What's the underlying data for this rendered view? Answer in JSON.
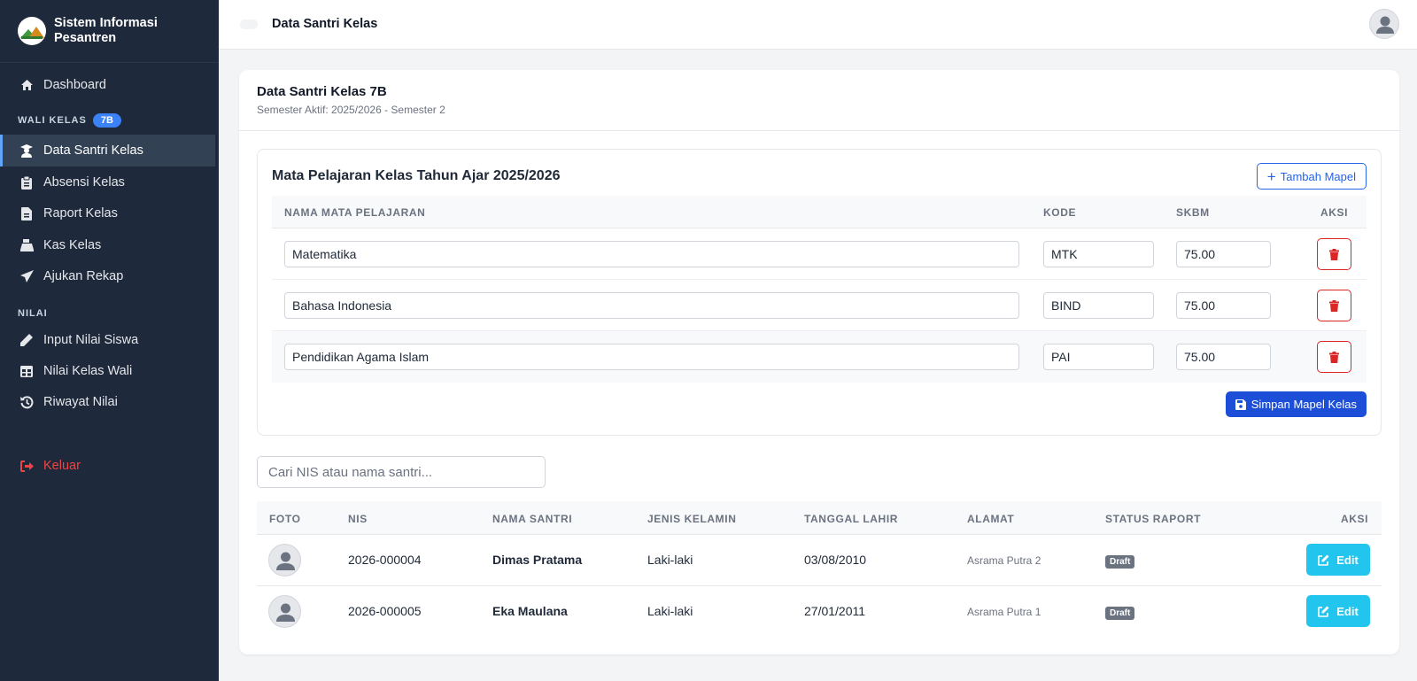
{
  "app": {
    "title": "Sistem Informasi Pesantren"
  },
  "sidebar": {
    "dashboard": "Dashboard",
    "section_wali": "WALI KELAS",
    "wali_badge": "7B",
    "items_wali": [
      {
        "label": "Data Santri Kelas",
        "icon": "user-graduate-icon"
      },
      {
        "label": "Absensi Kelas",
        "icon": "clipboard-icon"
      },
      {
        "label": "Raport Kelas",
        "icon": "file-icon"
      },
      {
        "label": "Kas Kelas",
        "icon": "cash-register-icon"
      },
      {
        "label": "Ajukan Rekap",
        "icon": "paper-plane-icon"
      }
    ],
    "section_nilai": "NILAI",
    "items_nilai": [
      {
        "label": "Input Nilai Siswa",
        "icon": "pencil-icon"
      },
      {
        "label": "Nilai Kelas Wali",
        "icon": "table-icon"
      },
      {
        "label": "Riwayat Nilai",
        "icon": "history-icon"
      }
    ],
    "logout": "Keluar"
  },
  "topbar": {
    "title": "Data Santri Kelas"
  },
  "card": {
    "title": "Data Santri Kelas 7B",
    "subtitle": "Semester Aktif: 2025/2026 - Semester 2"
  },
  "mapel": {
    "title": "Mata Pelajaran Kelas Tahun Ajar 2025/2026",
    "add_button": "Tambah Mapel",
    "headers": {
      "nama": "NAMA MATA PELAJARAN",
      "kode": "KODE",
      "skbm": "SKBM",
      "aksi": "AKSI"
    },
    "rows": [
      {
        "nama": "Matematika",
        "kode": "MTK",
        "skbm": "75.00"
      },
      {
        "nama": "Bahasa Indonesia",
        "kode": "BIND",
        "skbm": "75.00"
      },
      {
        "nama": "Pendidikan Agama Islam",
        "kode": "PAI",
        "skbm": "75.00"
      }
    ],
    "save_button": "Simpan Mapel Kelas"
  },
  "search": {
    "placeholder": "Cari NIS atau nama santri..."
  },
  "santri": {
    "headers": {
      "foto": "FOTO",
      "nis": "NIS",
      "nama": "NAMA SANTRI",
      "jk": "JENIS KELAMIN",
      "tgl": "TANGGAL LAHIR",
      "alamat": "ALAMAT",
      "status": "STATUS RAPORT",
      "aksi": "AKSI"
    },
    "rows": [
      {
        "nis": "2026-000004",
        "nama": "Dimas Pratama",
        "jk": "Laki-laki",
        "tgl": "03/08/2010",
        "alamat": "Asrama Putra 2",
        "status": "Draft",
        "edit": "Edit"
      },
      {
        "nis": "2026-000005",
        "nama": "Eka Maulana",
        "jk": "Laki-laki",
        "tgl": "27/01/2011",
        "alamat": "Asrama Putra 1",
        "status": "Draft",
        "edit": "Edit"
      }
    ]
  },
  "colors": {
    "sidebar_bg": "#1e293b",
    "primary": "#1d4ed8",
    "danger": "#dc2626",
    "info": "#22c5ee",
    "logout": "#ef4444"
  }
}
